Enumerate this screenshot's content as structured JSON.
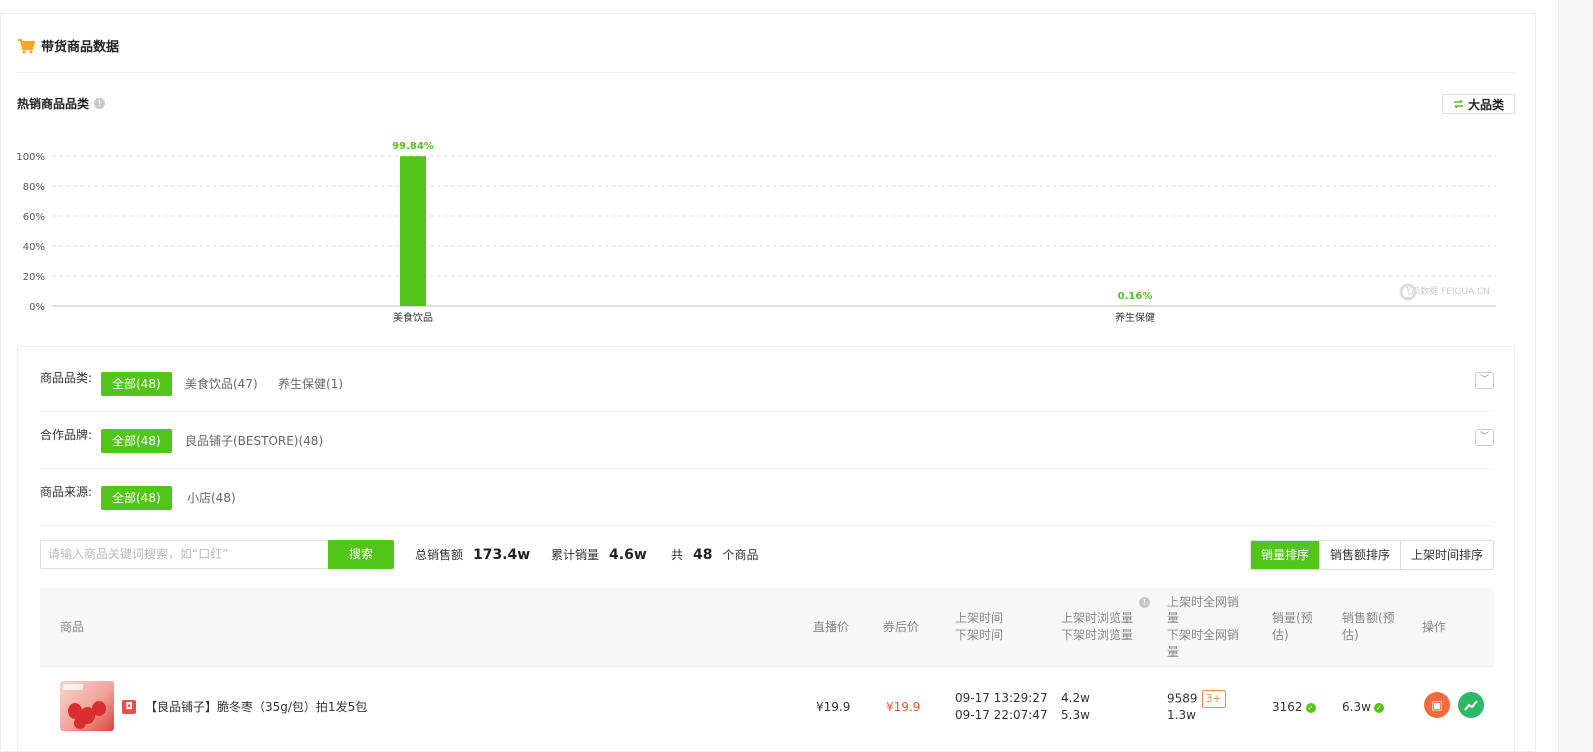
{
  "section": {
    "title": "带货商品数据"
  },
  "hot": {
    "title": "热销商品品类",
    "category_button": "大品类"
  },
  "chart_data": {
    "type": "bar",
    "categories": [
      "美食饮品",
      "养生保健"
    ],
    "values": [
      99.84,
      0.16
    ],
    "value_labels": [
      "99.84%",
      "0.16%"
    ],
    "title": "",
    "xlabel": "",
    "ylabel": "",
    "ylim": [
      0,
      100
    ],
    "yticks": [
      "0%",
      "20%",
      "40%",
      "60%",
      "80%",
      "100%"
    ],
    "grid": true,
    "bar_color": "#52c41a",
    "watermark": "飞瓜数据 FEIGUA.CN"
  },
  "filters": {
    "category": {
      "label": "商品品类:",
      "options": [
        "全部(48)",
        "美食饮品(47)",
        "养生保健(1)"
      ]
    },
    "brand": {
      "label": "合作品牌:",
      "options": [
        "全部(48)",
        "良品铺子(BESTORE)(48)"
      ]
    },
    "source": {
      "label": "商品来源:",
      "options": [
        "全部(48)",
        "小店(48)"
      ]
    }
  },
  "search": {
    "placeholder": "请输入商品关键词搜索，如“口红”",
    "button": "搜索"
  },
  "stats": {
    "total_sales_label": "总销售额",
    "total_sales": "173.4w",
    "volume_label": "累计销量",
    "volume": "4.6w",
    "count_prefix": "共",
    "count": "48",
    "count_suffix": "个商品"
  },
  "sort": [
    "销量排序",
    "销售额排序",
    "上架时间排序"
  ],
  "table": {
    "headers": {
      "product": "商品",
      "live_price": "直播价",
      "coupon_price": "券后价",
      "time_on": "上架时间",
      "time_off": "下架时间",
      "views_on": "上架时浏览量",
      "views_off": "下架时浏览量",
      "net_on_1": "上架时全网销",
      "net_on_2": "量",
      "net_off_1": "下架时全网销",
      "net_off_2": "量",
      "sales_1": "销量(预",
      "sales_2": "估)",
      "revenue_1": "销售额(预",
      "revenue_2": "估)",
      "ops": "操作"
    },
    "rows": [
      {
        "name": "【良品铺子】脆冬枣（35g/包）拍1发5包",
        "live_price": "¥19.9",
        "coupon_price": "¥19.9",
        "time_on": "09-17 13:29:27",
        "time_off": "09-17 22:07:47",
        "views_on": "4.2w",
        "views_off": "5.3w",
        "net_on": "9589",
        "net_badge": "3+",
        "net_off": "1.3w",
        "sales": "3162",
        "revenue": "6.3w"
      }
    ]
  },
  "colors": {
    "accent": "#52c41a",
    "price": "#f5542d",
    "cart": "#f7a81b"
  }
}
